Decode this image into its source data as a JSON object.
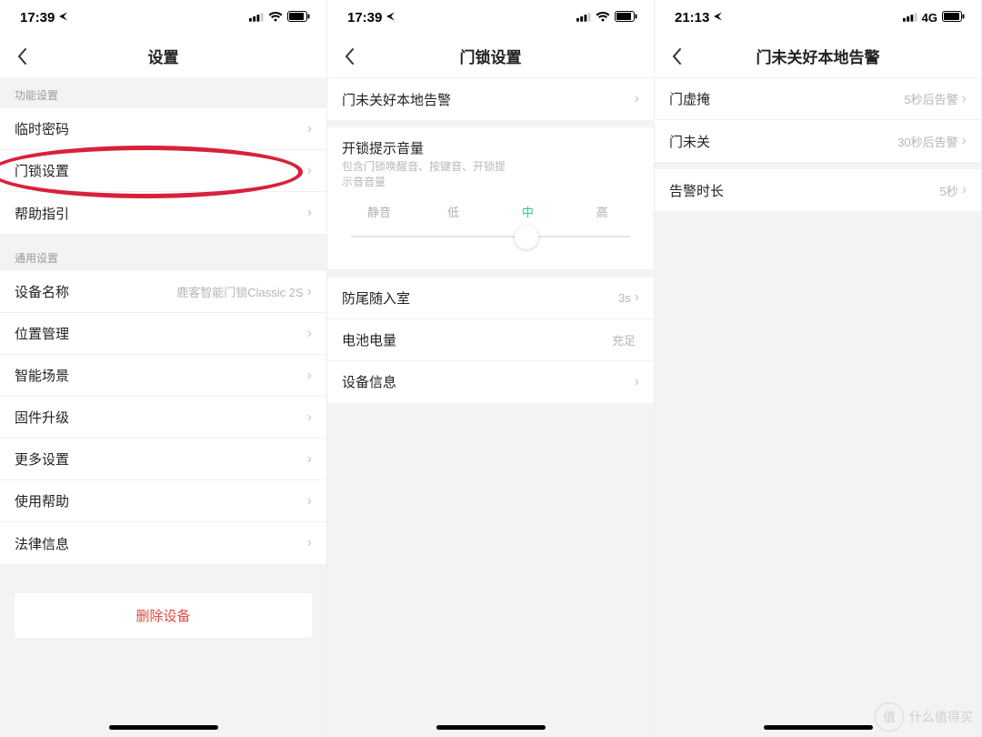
{
  "watermark": "什么值得买",
  "watermark_badge": "值",
  "screens": {
    "s1": {
      "time": "17:39",
      "signal_text": "",
      "title": "设置",
      "section1": "功能设置",
      "rows1": {
        "temp_pw": "临时密码",
        "lock_settings": "门锁设置",
        "help_guide": "帮助指引"
      },
      "section2": "通用设置",
      "rows2": {
        "device_name": "设备名称",
        "device_name_val": "鹿客智能门锁Classic 2S",
        "location": "位置管理",
        "scene": "智能场景",
        "firmware": "固件升级",
        "more": "更多设置",
        "use_help": "使用帮助",
        "legal": "法律信息"
      },
      "delete": "删除设备"
    },
    "s2": {
      "time": "17:39",
      "title": "门锁设置",
      "row_alarm": "门未关好本地告警",
      "vol_title": "开锁提示音量",
      "vol_sub": "包含门锁唤醒音、按键音、开锁提示音音量",
      "vol_opts": {
        "mute": "静音",
        "low": "低",
        "mid": "中",
        "high": "高"
      },
      "row_tail": "防尾随入室",
      "row_tail_val": "3s",
      "row_batt": "电池电量",
      "row_batt_val": "充足",
      "row_info": "设备信息"
    },
    "s3": {
      "time": "21:13",
      "network": "4G",
      "title": "门未关好本地告警",
      "row_ajar": "门虚掩",
      "row_ajar_val": "5秒后告警",
      "row_open": "门未关",
      "row_open_val": "30秒后告警",
      "row_dur": "告警时长",
      "row_dur_val": "5秒"
    }
  }
}
